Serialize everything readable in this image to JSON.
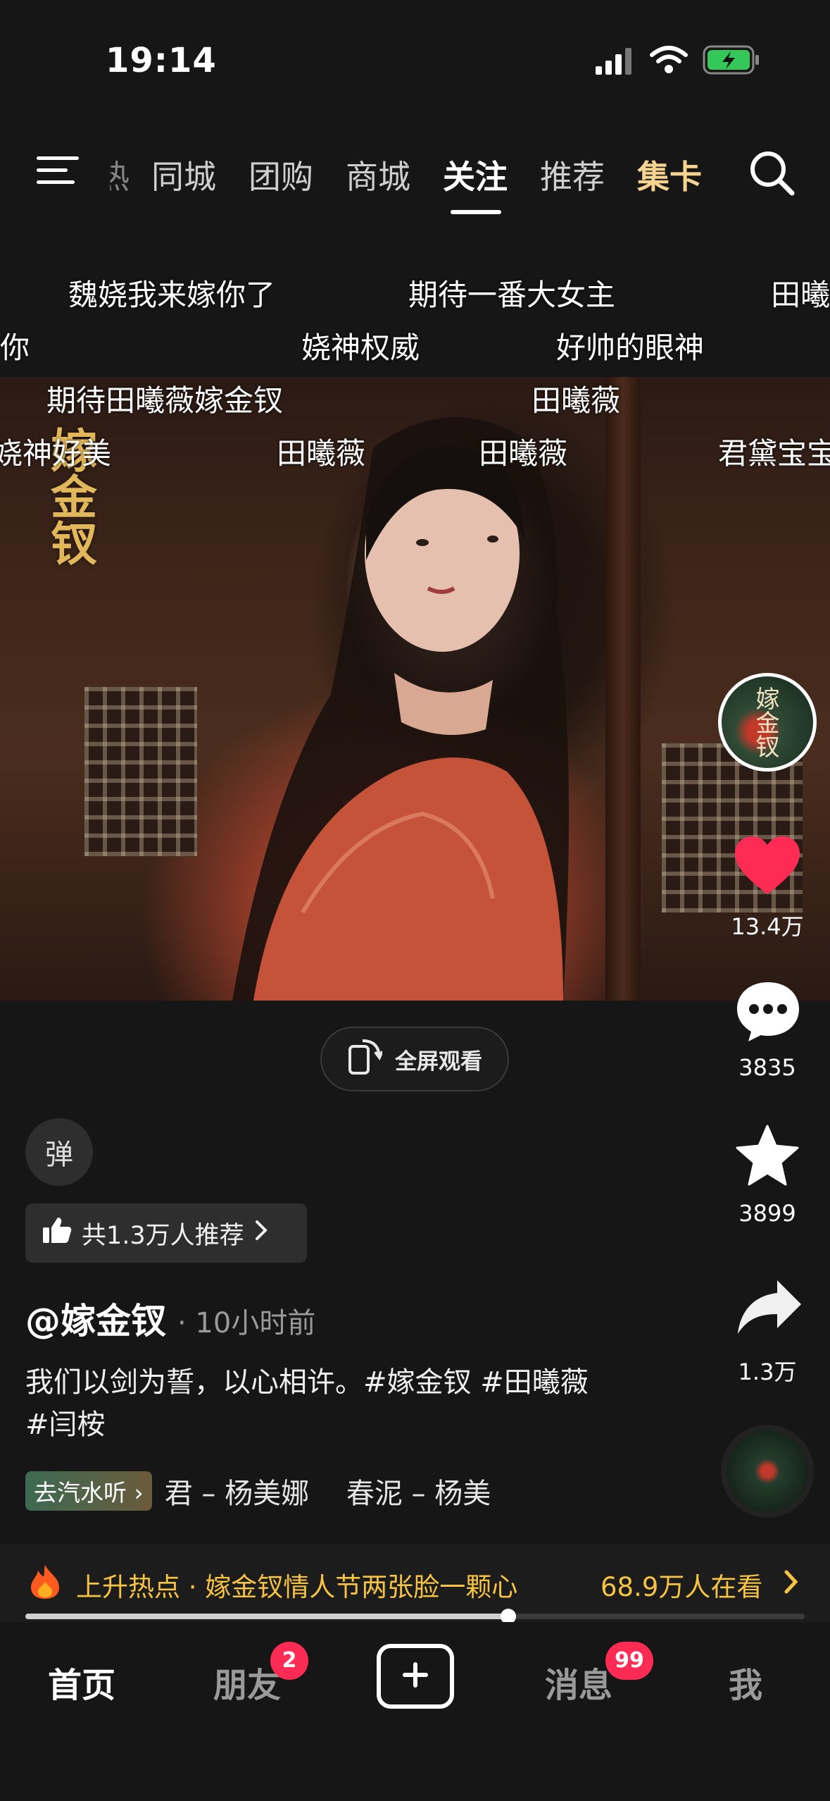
{
  "status_bar": {
    "time": "19:14"
  },
  "top_nav": {
    "partial_tab": "热",
    "tabs": [
      "同城",
      "团购",
      "商城",
      "关注",
      "推荐",
      "集卡"
    ],
    "active_tab": "关注"
  },
  "danmaku": [
    "魏娆我来嫁你了",
    "期待一番大女主",
    "田曦",
    "你",
    "娆神权威",
    "好帅的眼神",
    "期待田曦薇嫁金钗",
    "田曦薇",
    "娆神好美",
    "田曦薇",
    "田曦薇",
    "君黛宝宝"
  ],
  "video": {
    "watermark": "嫁金钗"
  },
  "side_actions": {
    "likes": "13.4万",
    "comments": "3835",
    "favorites": "3899",
    "shares": "1.3万"
  },
  "fullscreen_label": "全屏观看",
  "danmu_toggle": "弹",
  "recommend": "共1.3万人推荐",
  "post": {
    "author": "@嫁金钗",
    "time": "· 10小时前",
    "caption": "我们以剑为誓，以心相许。#嫁金钗 #田曦薇 #闫桉"
  },
  "music": {
    "badge": "去汽水听",
    "track": "君 – 杨美娜　 春泥 – 杨美"
  },
  "hot": {
    "title": "上升热点 · 嫁金钗情人节两张脸一颗心",
    "viewers": "68.9万人在看"
  },
  "progress": {
    "fraction": 0.62
  },
  "bottom_tabs": {
    "home": "首页",
    "friends": "朋友",
    "friends_badge": "2",
    "messages": "消息",
    "messages_badge": "99",
    "me": "我"
  },
  "colors": {
    "accent": "#fe2c55",
    "gold": "#f6c342",
    "like": "#fe2c55"
  }
}
